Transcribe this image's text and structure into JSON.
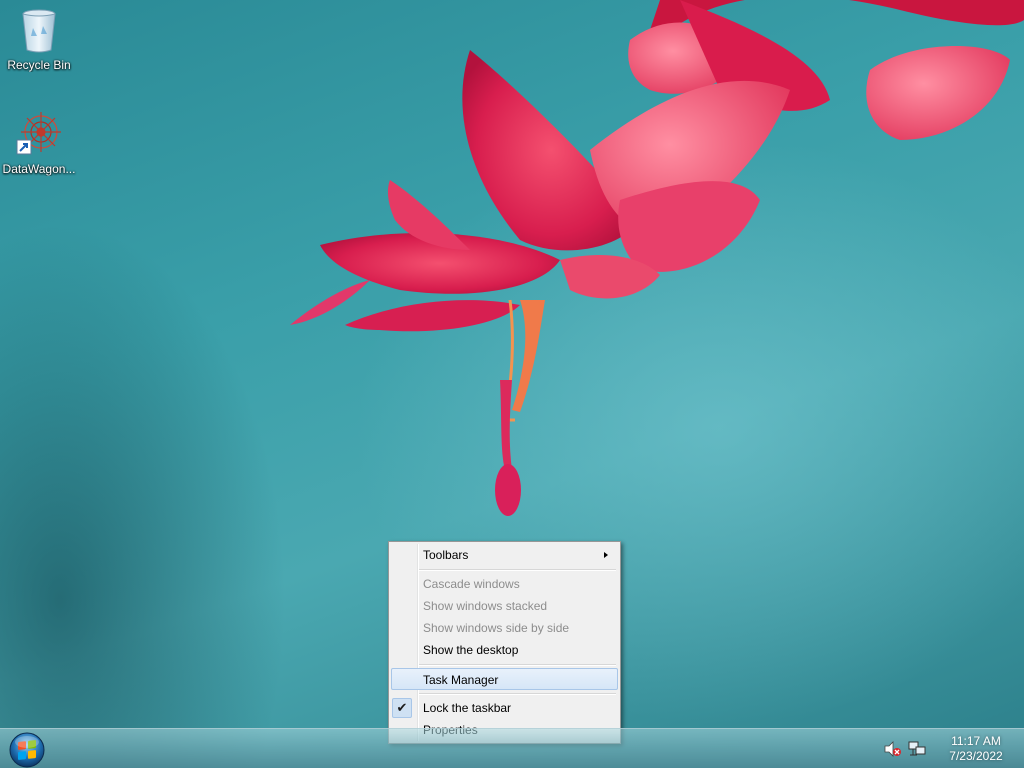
{
  "desktop": {
    "icons": [
      {
        "label": "Recycle Bin",
        "icon": "recycle-bin-icon"
      },
      {
        "label": "DataWagon...",
        "icon": "datawagon-app-icon"
      }
    ]
  },
  "context_menu": {
    "items": [
      {
        "label": "Toolbars",
        "enabled": true,
        "has_submenu": true
      },
      {
        "label": "Cascade windows",
        "enabled": false
      },
      {
        "label": "Show windows stacked",
        "enabled": false
      },
      {
        "label": "Show windows side by side",
        "enabled": false
      },
      {
        "label": "Show the desktop",
        "enabled": true
      },
      {
        "label": "Task Manager",
        "enabled": true,
        "highlighted": true
      },
      {
        "label": "Lock the taskbar",
        "enabled": true,
        "checked": true
      },
      {
        "label": "Properties",
        "enabled": true
      }
    ]
  },
  "taskbar": {
    "start_icon": "windows-start-orb-icon",
    "tray": {
      "volume_icon": "volume-muted-icon",
      "network_icon": "network-icon",
      "time": "11:17 AM",
      "date": "7/23/2022"
    }
  },
  "colors": {
    "menu_background": "#f0f0f0",
    "menu_highlight": "#d6e6f7",
    "disabled_text": "#8d8d8d",
    "wallpaper_teal": "#3a9fa9",
    "flower_pink": "#e0245e"
  }
}
